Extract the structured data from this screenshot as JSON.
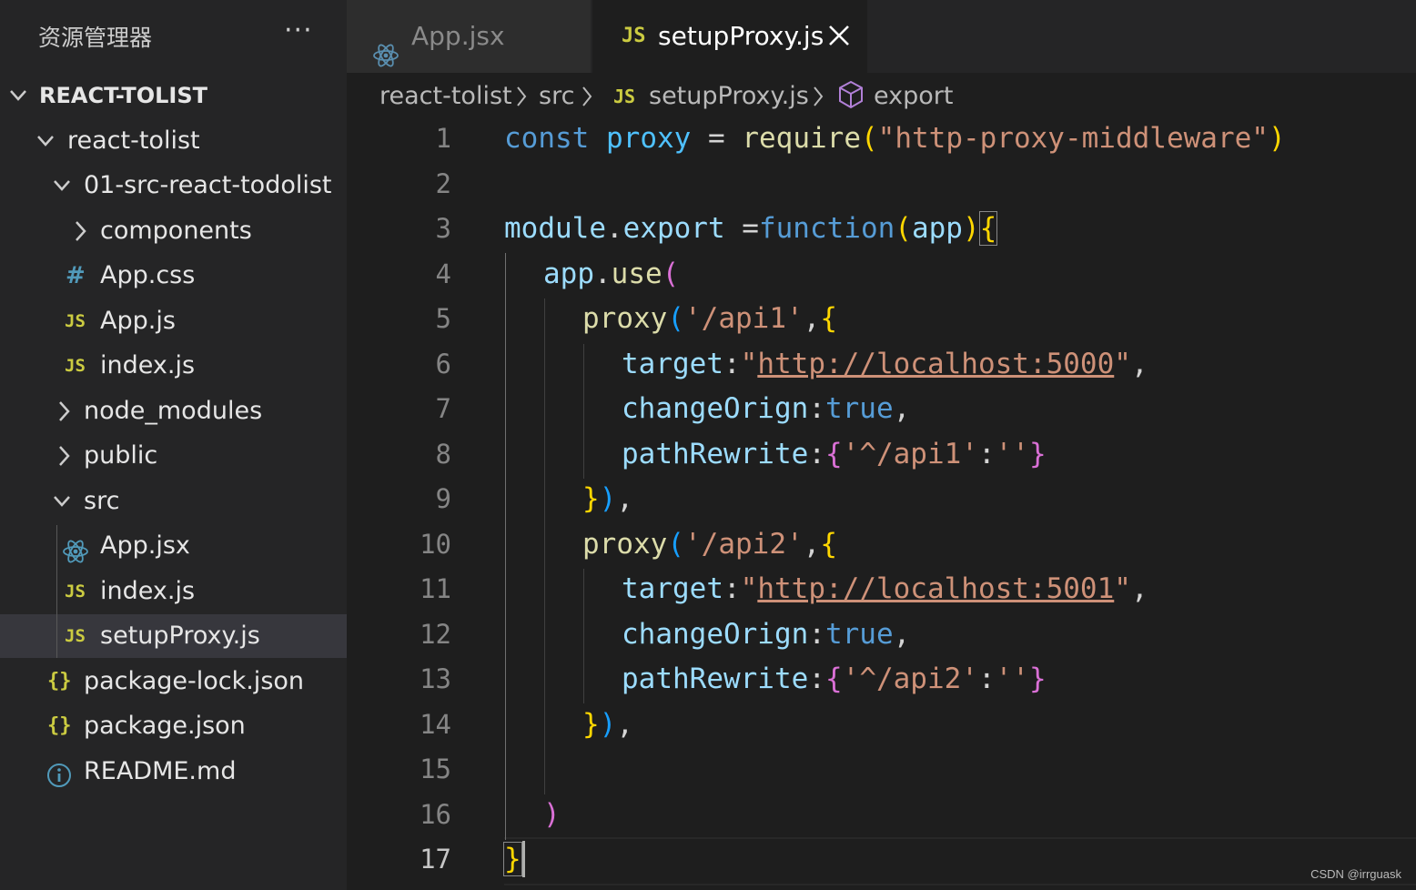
{
  "sidebar": {
    "title": "资源管理器",
    "more_label": "···",
    "root": "REACT-TOLIST",
    "items": [
      {
        "label": "react-tolist",
        "kind": "folder-open"
      },
      {
        "label": "01-src-react-todolist",
        "kind": "folder-open"
      },
      {
        "label": "components",
        "kind": "folder-closed"
      },
      {
        "label": "App.css",
        "kind": "css"
      },
      {
        "label": "App.js",
        "kind": "js"
      },
      {
        "label": "index.js",
        "kind": "js"
      },
      {
        "label": "node_modules",
        "kind": "folder-closed"
      },
      {
        "label": "public",
        "kind": "folder-closed"
      },
      {
        "label": "src",
        "kind": "folder-open"
      },
      {
        "label": "App.jsx",
        "kind": "react"
      },
      {
        "label": "index.js",
        "kind": "js"
      },
      {
        "label": "setupProxy.js",
        "kind": "js",
        "selected": true
      },
      {
        "label": "package-lock.json",
        "kind": "json"
      },
      {
        "label": "package.json",
        "kind": "json"
      },
      {
        "label": "README.md",
        "kind": "info"
      }
    ]
  },
  "icons": {
    "js": "JS",
    "json": "{}",
    "css": "#",
    "chevron_down": "chevron-down-icon",
    "chevron_right": "chevron-right-icon",
    "react": "react-icon",
    "info": "info-icon",
    "close": "close-icon",
    "symbol": "symbol-module-icon"
  },
  "tabs": [
    {
      "label": "App.jsx",
      "icon": "react-icon",
      "active": false
    },
    {
      "label": "setupProxy.js",
      "icon": "JS",
      "active": true
    }
  ],
  "breadcrumb": [
    "react-tolist",
    "src",
    "setupProxy.js",
    "export"
  ],
  "editor": {
    "line_numbers": [
      "1",
      "2",
      "3",
      "4",
      "5",
      "6",
      "7",
      "8",
      "9",
      "10",
      "11",
      "12",
      "13",
      "14",
      "15",
      "16",
      "17"
    ],
    "tokens": {
      "l1": [
        "const",
        "proxy",
        "=",
        "require",
        "(",
        "\"http-proxy-middleware\"",
        ")"
      ],
      "l3": [
        "module",
        ".",
        "export",
        " =",
        "function",
        "(",
        "app",
        ")",
        "{"
      ],
      "l4": [
        "app",
        ".",
        "use",
        "("
      ],
      "l5": [
        "proxy",
        "(",
        "'/api1'",
        ",",
        "{"
      ],
      "l6": [
        "target",
        ":",
        "\"",
        "http://localhost:5000",
        "\"",
        ","
      ],
      "l7": [
        "changeOrign",
        ":",
        "true",
        ","
      ],
      "l8": [
        "pathRewrite",
        ":",
        "{",
        "'^/api1'",
        ":",
        "''",
        "}"
      ],
      "l9": [
        "}",
        ")",
        ","
      ],
      "l10": [
        "proxy",
        "(",
        "'/api2'",
        ",",
        "{"
      ],
      "l11": [
        "target",
        ":",
        "\"",
        "http://localhost:5001",
        "\"",
        ","
      ],
      "l12": [
        "changeOrign",
        ":",
        "true",
        ","
      ],
      "l13": [
        "pathRewrite",
        ":",
        "{",
        "'^/api2'",
        ":",
        "''",
        "}"
      ],
      "l14": [
        "}",
        ")",
        ","
      ],
      "l16": [
        ")"
      ],
      "l17": [
        "}"
      ]
    }
  },
  "watermark": "CSDN @irrguask",
  "colors": {
    "sidebar_bg": "#252526",
    "editor_bg": "#1e1e1e",
    "keyword": "#569cd6",
    "string": "#ce9178",
    "property": "#9cdcfe",
    "function": "#dcdcaa",
    "js_icon": "#cbcb41"
  }
}
